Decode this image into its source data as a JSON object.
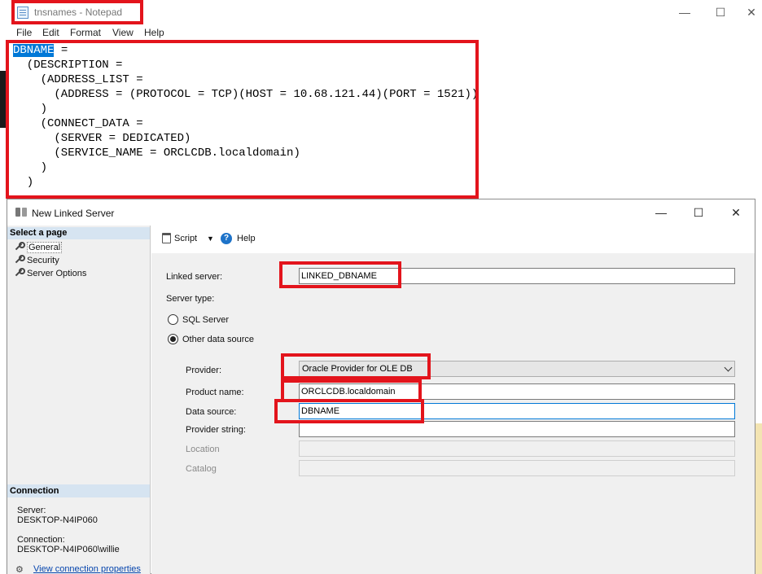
{
  "notepad": {
    "title": "tnsnames - Notepad",
    "window_buttons": {
      "minimize": "—",
      "maximize": "☐",
      "close": "✕"
    },
    "menu": [
      "File",
      "Edit",
      "Format",
      "View",
      "Help"
    ],
    "lines": [
      {
        "selected": "DBNAME",
        "rest": " ="
      },
      {
        "text": "  (DESCRIPTION ="
      },
      {
        "text": "    (ADDRESS_LIST ="
      },
      {
        "text": "      (ADDRESS = (PROTOCOL = TCP)(HOST = 10.68.121.44)(PORT = 1521))"
      },
      {
        "text": "    )"
      },
      {
        "text": "    (CONNECT_DATA ="
      },
      {
        "text": "      (SERVER = DEDICATED)"
      },
      {
        "text": "      (SERVICE_NAME = ORCLCDB.localdomain)"
      },
      {
        "text": "    )"
      },
      {
        "text": "  )"
      }
    ]
  },
  "dialog": {
    "title": "New Linked Server",
    "window_buttons": {
      "minimize": "—",
      "maximize": "☐",
      "close": "✕"
    },
    "sidebar": {
      "header": "Select a page",
      "items": [
        "General",
        "Security",
        "Server Options"
      ],
      "connection_header": "Connection",
      "server_label": "Server:",
      "server_value": "DESKTOP-N4IP060",
      "connection_label": "Connection:",
      "connection_value": "DESKTOP-N4IP060\\willie",
      "link": "View connection properties"
    },
    "toolbar": {
      "script": "Script",
      "help": "Help"
    },
    "form": {
      "linked_server_label": "Linked server:",
      "linked_server_value": "LINKED_DBNAME",
      "server_type_label": "Server type:",
      "radio_sql": "SQL Server",
      "radio_other": "Other data source",
      "provider_label": "Provider:",
      "provider_value": "Oracle Provider for OLE DB",
      "product_label": "Product name:",
      "product_value": "ORCLCDB.localdomain",
      "datasource_label": "Data source:",
      "datasource_value": "DBNAME",
      "provider_string_label": "Provider string:",
      "provider_string_value": "",
      "location_label": "Location",
      "catalog_label": "Catalog"
    }
  },
  "colors": {
    "highlight": "#e3141c",
    "selection": "#0078d7",
    "sidebar_header": "#d6e4f1"
  }
}
